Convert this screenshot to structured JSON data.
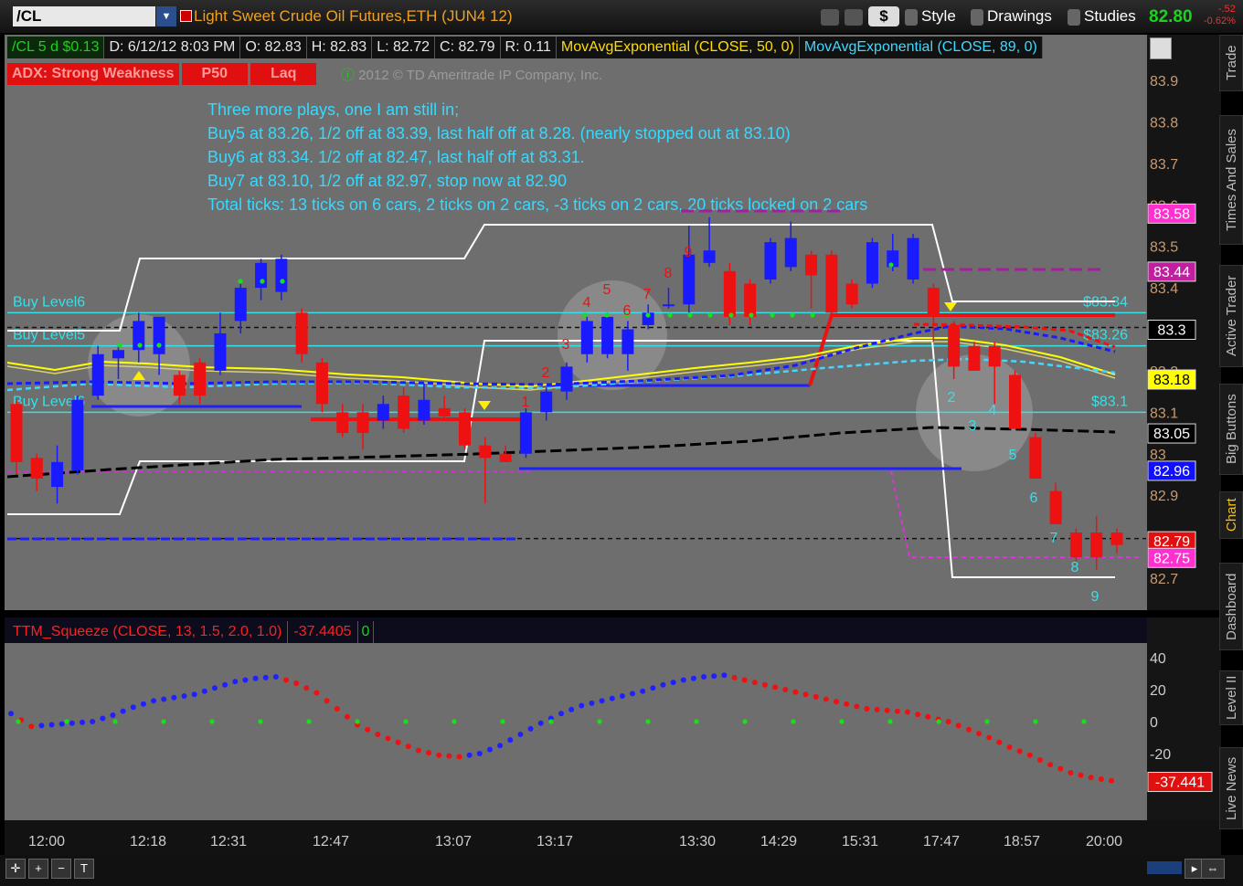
{
  "toolbar": {
    "symbol": "/CL",
    "title": "Light Sweet Crude Oil Futures,ETH (JUN4 12)",
    "style_label": "Style",
    "drawings_label": "Drawings",
    "studies_label": "Studies",
    "dollar_label": "$",
    "last_price": "82.80",
    "change": "-.52",
    "change_pct": "-0.62%"
  },
  "infobar": {
    "symbol_tf": "/CL 5 d $0.13",
    "date": "D: 6/12/12 8:03 PM",
    "open": "O: 82.83",
    "high": "H: 82.83",
    "low": "L: 82.72",
    "close": "C: 82.79",
    "range": "R: 0.11",
    "ma50": "MovAvgExponential (CLOSE, 50, 0)",
    "ma89": "MovAvgExponential (CLOSE, 89, 0)"
  },
  "adx": {
    "status": "ADX:  Strong Weakness",
    "p": "P50",
    "lag": "Laq"
  },
  "copyright": "2012 © TD Ameritrade IP Company, Inc.",
  "notes": [
    "Three more plays, one I am still in;",
    "Buy5 at 83.26, 1/2 off at 83.39, last half off at 8.28. (nearly stopped out at 83.10)",
    "Buy6 at 83.34. 1/2 off at 82.47, last half off at 83.31.",
    "Buy7 at 83.10, 1/2 off at 82.97, stop now at 82.90",
    "Total ticks: 13 ticks on 6 cars, 2 ticks on 2 cars, -3 ticks on 2 cars, 20 ticks locked on 2 cars"
  ],
  "side_tabs": [
    "Trade",
    "Times And Sales",
    "Active Trader",
    "Big Buttons",
    "Chart",
    "Dashboard",
    "Level II",
    "Live News"
  ],
  "active_tab": "Chart",
  "colors": {
    "bull": "#1a1aff",
    "bear": "#ee1111",
    "level": "#36e0e6",
    "ema50": "#ffff00",
    "ema89": "#40d8ff",
    "envelope": "#ffffff",
    "count": "#ee1111",
    "count_down": "#36e0e6"
  },
  "chart_data": [
    {
      "type": "candlestick",
      "y_axis_ticks": [
        "83.9",
        "83.8",
        "83.7",
        "83.6",
        "83.5",
        "83.4",
        "83.3",
        "83.2",
        "83.1",
        "83",
        "82.9",
        "82.8",
        "82.7"
      ],
      "ylim": [
        82.66,
        83.98
      ],
      "x_tick_labels": [
        "12:00",
        "12:18",
        "12:31",
        "12:47",
        "13:07",
        "13:17",
        "13:30",
        "14:29",
        "15:31",
        "17:47",
        "18:57",
        "20:00"
      ],
      "candles": [
        {
          "o": 83.12,
          "h": 83.13,
          "l": 82.95,
          "c": 82.98
        },
        {
          "o": 82.99,
          "h": 83.0,
          "l": 82.91,
          "c": 82.94
        },
        {
          "o": 82.92,
          "h": 83.02,
          "l": 82.88,
          "c": 82.98
        },
        {
          "o": 82.96,
          "h": 83.14,
          "l": 82.95,
          "c": 83.13
        },
        {
          "o": 83.14,
          "h": 83.26,
          "l": 83.13,
          "c": 83.24
        },
        {
          "o": 83.23,
          "h": 83.26,
          "l": 83.18,
          "c": 83.25
        },
        {
          "o": 83.25,
          "h": 83.34,
          "l": 83.22,
          "c": 83.32
        },
        {
          "o": 83.24,
          "h": 83.32,
          "l": 83.19,
          "c": 83.33
        },
        {
          "o": 83.19,
          "h": 83.2,
          "l": 83.12,
          "c": 83.14
        },
        {
          "o": 83.22,
          "h": 83.23,
          "l": 83.12,
          "c": 83.14
        },
        {
          "o": 83.2,
          "h": 83.34,
          "l": 83.19,
          "c": 83.29
        },
        {
          "o": 83.32,
          "h": 83.42,
          "l": 83.29,
          "c": 83.4
        },
        {
          "o": 83.4,
          "h": 83.47,
          "l": 83.37,
          "c": 83.46
        },
        {
          "o": 83.39,
          "h": 83.48,
          "l": 83.37,
          "c": 83.47
        },
        {
          "o": 83.34,
          "h": 83.35,
          "l": 83.22,
          "c": 83.24
        },
        {
          "o": 83.22,
          "h": 83.23,
          "l": 83.1,
          "c": 83.12
        },
        {
          "o": 83.1,
          "h": 83.12,
          "l": 83.04,
          "c": 83.05
        },
        {
          "o": 83.1,
          "h": 83.12,
          "l": 83.01,
          "c": 83.05
        },
        {
          "o": 83.08,
          "h": 83.14,
          "l": 83.06,
          "c": 83.12
        },
        {
          "o": 83.14,
          "h": 83.16,
          "l": 83.05,
          "c": 83.06
        },
        {
          "o": 83.08,
          "h": 83.17,
          "l": 83.07,
          "c": 83.13
        },
        {
          "o": 83.11,
          "h": 83.14,
          "l": 83.08,
          "c": 83.09
        },
        {
          "o": 83.1,
          "h": 83.11,
          "l": 83.01,
          "c": 83.02
        },
        {
          "o": 83.02,
          "h": 83.04,
          "l": 82.88,
          "c": 82.99
        },
        {
          "o": 83.0,
          "h": 83.02,
          "l": 82.98,
          "c": 82.98
        },
        {
          "o": 83.0,
          "h": 83.11,
          "l": 82.99,
          "c": 83.1
        },
        {
          "o": 83.1,
          "h": 83.16,
          "l": 83.08,
          "c": 83.15
        },
        {
          "o": 83.15,
          "h": 83.22,
          "l": 83.13,
          "c": 83.21
        },
        {
          "o": 83.24,
          "h": 83.33,
          "l": 83.22,
          "c": 83.32
        },
        {
          "o": 83.24,
          "h": 83.34,
          "l": 83.23,
          "c": 83.33
        },
        {
          "o": 83.24,
          "h": 83.32,
          "l": 83.2,
          "c": 83.3
        },
        {
          "o": 83.31,
          "h": 83.36,
          "l": 83.3,
          "c": 83.34
        },
        {
          "o": 83.36,
          "h": 83.4,
          "l": 83.35,
          "c": 83.36
        },
        {
          "o": 83.36,
          "h": 83.55,
          "l": 83.34,
          "c": 83.48
        },
        {
          "o": 83.46,
          "h": 83.57,
          "l": 83.45,
          "c": 83.49
        },
        {
          "o": 83.44,
          "h": 83.46,
          "l": 83.31,
          "c": 83.33
        },
        {
          "o": 83.41,
          "h": 83.42,
          "l": 83.31,
          "c": 83.33
        },
        {
          "o": 83.42,
          "h": 83.52,
          "l": 83.41,
          "c": 83.51
        },
        {
          "o": 83.45,
          "h": 83.56,
          "l": 83.44,
          "c": 83.52
        },
        {
          "o": 83.48,
          "h": 83.49,
          "l": 83.35,
          "c": 83.43
        },
        {
          "o": 83.48,
          "h": 83.49,
          "l": 83.33,
          "c": 83.34
        },
        {
          "o": 83.41,
          "h": 83.42,
          "l": 83.35,
          "c": 83.36
        },
        {
          "o": 83.41,
          "h": 83.52,
          "l": 83.4,
          "c": 83.51
        },
        {
          "o": 83.45,
          "h": 83.53,
          "l": 83.44,
          "c": 83.49
        },
        {
          "o": 83.42,
          "h": 83.53,
          "l": 83.41,
          "c": 83.52
        },
        {
          "o": 83.4,
          "h": 83.41,
          "l": 83.27,
          "c": 83.33
        },
        {
          "o": 83.31,
          "h": 83.32,
          "l": 83.18,
          "c": 83.21
        },
        {
          "o": 83.26,
          "h": 83.27,
          "l": 83.21,
          "c": 83.2
        },
        {
          "o": 83.26,
          "h": 83.27,
          "l": 83.12,
          "c": 83.21
        },
        {
          "o": 83.19,
          "h": 83.2,
          "l": 83.06,
          "c": 83.06
        },
        {
          "o": 83.04,
          "h": 83.05,
          "l": 82.94,
          "c": 82.94
        },
        {
          "o": 82.91,
          "h": 82.93,
          "l": 82.83,
          "c": 82.83
        },
        {
          "o": 82.81,
          "h": 82.82,
          "l": 82.74,
          "c": 82.75
        },
        {
          "o": 82.81,
          "h": 82.85,
          "l": 82.72,
          "c": 82.75
        },
        {
          "o": 82.81,
          "h": 82.82,
          "l": 82.76,
          "c": 82.78
        }
      ],
      "levels": [
        {
          "name": "Buy Level6",
          "price": 83.34,
          "label": "$83.34"
        },
        {
          "name": "Buy Level5",
          "price": 83.26,
          "label": "$83.26"
        },
        {
          "name": "Buy Level6",
          "price": 83.1,
          "label": "$83.1"
        }
      ],
      "price_labels": [
        {
          "value": "83.58",
          "bg": "#ff2fd0"
        },
        {
          "value": "83.44",
          "bg": "#c020a0"
        },
        {
          "value": "83.3",
          "bg": "#000000"
        },
        {
          "value": "83.18",
          "bg": "#ffff00"
        },
        {
          "value": "83.05",
          "bg": "#000000"
        },
        {
          "value": "82.96",
          "bg": "#1010ff"
        },
        {
          "value": "82.79",
          "bg": "#e01010"
        },
        {
          "value": "82.75",
          "bg": "#ff2fd0"
        }
      ],
      "counts_up": [
        "1",
        "2",
        "3",
        "4",
        "5",
        "6",
        "7",
        "8",
        "9"
      ],
      "counts_down": [
        "2",
        "3",
        "4",
        "5",
        "6",
        "7",
        "8",
        "9"
      ]
    },
    {
      "type": "line",
      "title": "TTM_Squeeze (CLOSE, 13, 1.5, 2.0, 1.0)",
      "value_label": "-37.4405",
      "signal_label": "0",
      "last_value": "-37.441",
      "y_axis_ticks": [
        "40",
        "20",
        "0",
        "-20"
      ],
      "ylim": [
        -55,
        48
      ],
      "series": [
        {
          "values": [
            5,
            -3,
            -2,
            -1,
            0,
            4,
            9,
            13,
            15,
            17,
            21,
            25,
            27,
            28,
            24,
            18,
            8,
            -2,
            -8,
            -13,
            -18,
            -21,
            -22,
            -20,
            -15,
            -8,
            -1,
            5,
            10,
            13,
            16,
            19,
            23,
            26,
            28,
            29,
            26,
            23,
            20,
            17,
            14,
            11,
            8,
            7,
            6,
            3,
            0,
            -5,
            -10,
            -16,
            -21,
            -27,
            -32,
            -35,
            -37
          ]
        }
      ]
    }
  ]
}
